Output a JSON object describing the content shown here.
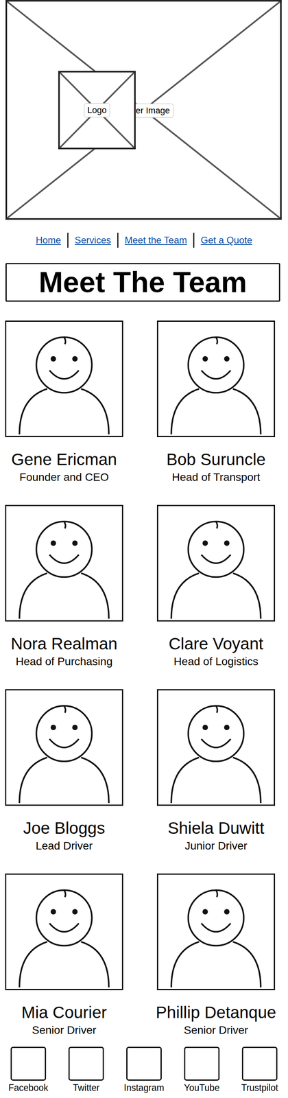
{
  "header": {
    "logo": "Logo",
    "image_label": "er Image"
  },
  "nav": [
    {
      "label": "Home"
    },
    {
      "label": "Services"
    },
    {
      "label": "Meet the Team"
    },
    {
      "label": "Get a Quote"
    }
  ],
  "title": "Meet The Team",
  "team": [
    {
      "name": "Gene Ericman",
      "role": "Founder and CEO"
    },
    {
      "name": "Bob Suruncle",
      "role": "Head of Transport"
    },
    {
      "name": "Nora Realman",
      "role": "Head of Purchasing"
    },
    {
      "name": "Clare Voyant",
      "role": "Head of Logistics"
    },
    {
      "name": "Joe Bloggs",
      "role": "Lead Driver"
    },
    {
      "name": "Shiela Duwitt",
      "role": "Junior Driver"
    },
    {
      "name": "Mia Courier",
      "role": "Senior Driver"
    },
    {
      "name": "Phillip Detanque",
      "role": "Senior Driver"
    }
  ],
  "footer": [
    {
      "label": "Facebook"
    },
    {
      "label": "Twitter"
    },
    {
      "label": "Instagram"
    },
    {
      "label": "YouTube"
    },
    {
      "label": "Trustpilot"
    }
  ]
}
